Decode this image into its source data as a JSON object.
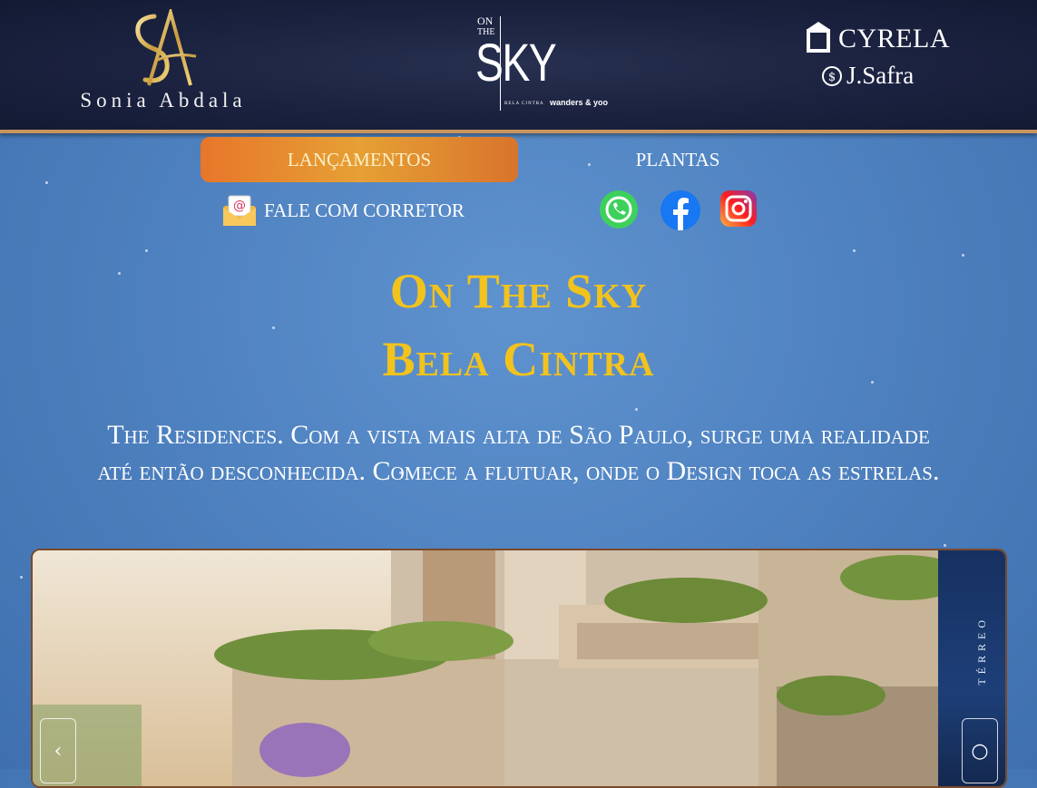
{
  "header": {
    "brand_left": "Sonia Abdala",
    "brand_left_monogram": "SA",
    "brand_center": {
      "on": "ON",
      "the": "THE",
      "sky": "SKY",
      "sub": "BELA CINTRA",
      "partner": "wanders & yoo"
    },
    "brand_right_1": "CYRELA",
    "brand_right_2": "J.Safra"
  },
  "nav": {
    "lancamentos": "LANÇAMENTOS",
    "plantas": "PLANTAS",
    "contact": "FALE COM CORRETOR"
  },
  "social": [
    "whatsapp-icon",
    "facebook-icon",
    "instagram-icon"
  ],
  "hero": {
    "title": "On The Sky",
    "subtitle": "Bela Cintra",
    "description": "The Residences. Com a vista mais alta de São Paulo, surge uma realidade até então desconhecida. Comece a flutuar, onde o Design toca as estrelas."
  },
  "gallery": {
    "side_label": "TÉRREO",
    "prev_arrow": "‹",
    "next_arrow": "○"
  },
  "colors": {
    "accent_gold": "#f2c21d",
    "header_bg": "#1b2240",
    "page_bg": "#4f82c0",
    "button_orange": "#e6a034"
  }
}
